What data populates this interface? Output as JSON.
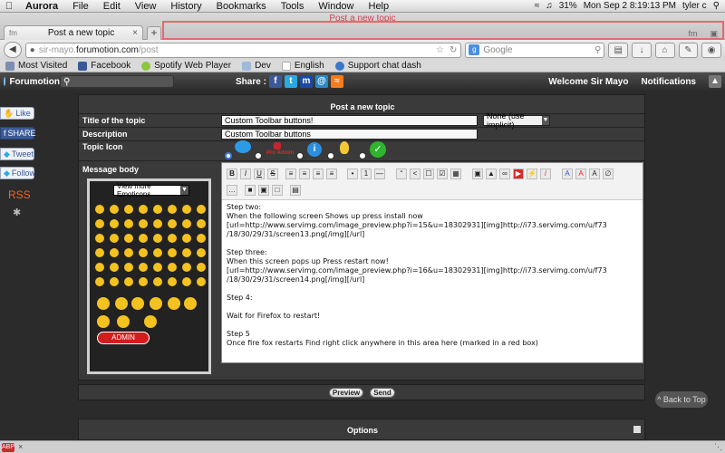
{
  "menubar": {
    "app": "Aurora",
    "items": [
      "File",
      "Edit",
      "View",
      "History",
      "Bookmarks",
      "Tools",
      "Window",
      "Help"
    ],
    "battery": "31%",
    "datetime": "Mon Sep 2  8:19:13 PM",
    "user": "tyler c"
  },
  "window": {
    "title": "Post a new topic"
  },
  "tab": {
    "title": "Post a new topic",
    "close": "×",
    "new": "+"
  },
  "nav": {
    "url_prefix": "sir-mayo.",
    "url_domain": "forumotion.com",
    "url_path": "/post",
    "search_placeholder": "Google"
  },
  "bookmarks": [
    {
      "label": "Most Visited",
      "color": "#7c8fb3"
    },
    {
      "label": "Facebook",
      "color": "#3b5998"
    },
    {
      "label": "Spotify Web Player",
      "color": "#8cc63f"
    },
    {
      "label": "Dev",
      "color": "#9fb9d9"
    },
    {
      "label": "English",
      "color": "#aaaaaa"
    },
    {
      "label": "Support chat dash",
      "color": "#3b78c9"
    }
  ],
  "forumbar": {
    "logo": "Forumotion",
    "share": "Share :",
    "welcome": "Welcome Sir Mayo",
    "notifications": "Notifications"
  },
  "social": {
    "like": "Like",
    "share": "SHARE",
    "tweet": "Tweet",
    "follow": "Follow",
    "rss": "RSS"
  },
  "form": {
    "panel_title": "Post a new topic",
    "title_label": "Title of the topic",
    "title_value": "Custom Toolbar buttons!",
    "type_value": "None (use implicit)",
    "description_label": "Description",
    "description_value": "Custom Toolbar buttons",
    "icon_label": "Topic Icon",
    "message_label": "Message body",
    "emoticons_select": "View more Emoticons",
    "pro_admin": "Pro Admin",
    "admin_badge": "ADMIN",
    "body_text": "Step two:\nWhen the following screen Shows up press install now\n[url=http://www.servimg.com/image_preview.php?i=15&u=18302931][img]http://i73.servimg.com/u/f73\n/18/30/29/31/screen13.png[/img][/url]\n\nStep three:\nWhen this screen pops up Press restart now!\n[url=http://www.servimg.com/image_preview.php?i=16&u=18302931][img]http://i73.servimg.com/u/f73\n/18/30/29/31/screen14.png[/img][/url]\n\nStep 4:\n\nWait for Firefox to restart!\n\nStep 5\nOnce fire fox restarts Find right click anywhere in this area here (marked in a red box)"
  },
  "buttons": {
    "preview": "Preview",
    "send": "Send"
  },
  "backtotop": "^ Back to Top",
  "options": {
    "label": "Options"
  },
  "colors": {
    "accent_red": "#e36b6b",
    "panel_bg": "#3a3a3a"
  }
}
